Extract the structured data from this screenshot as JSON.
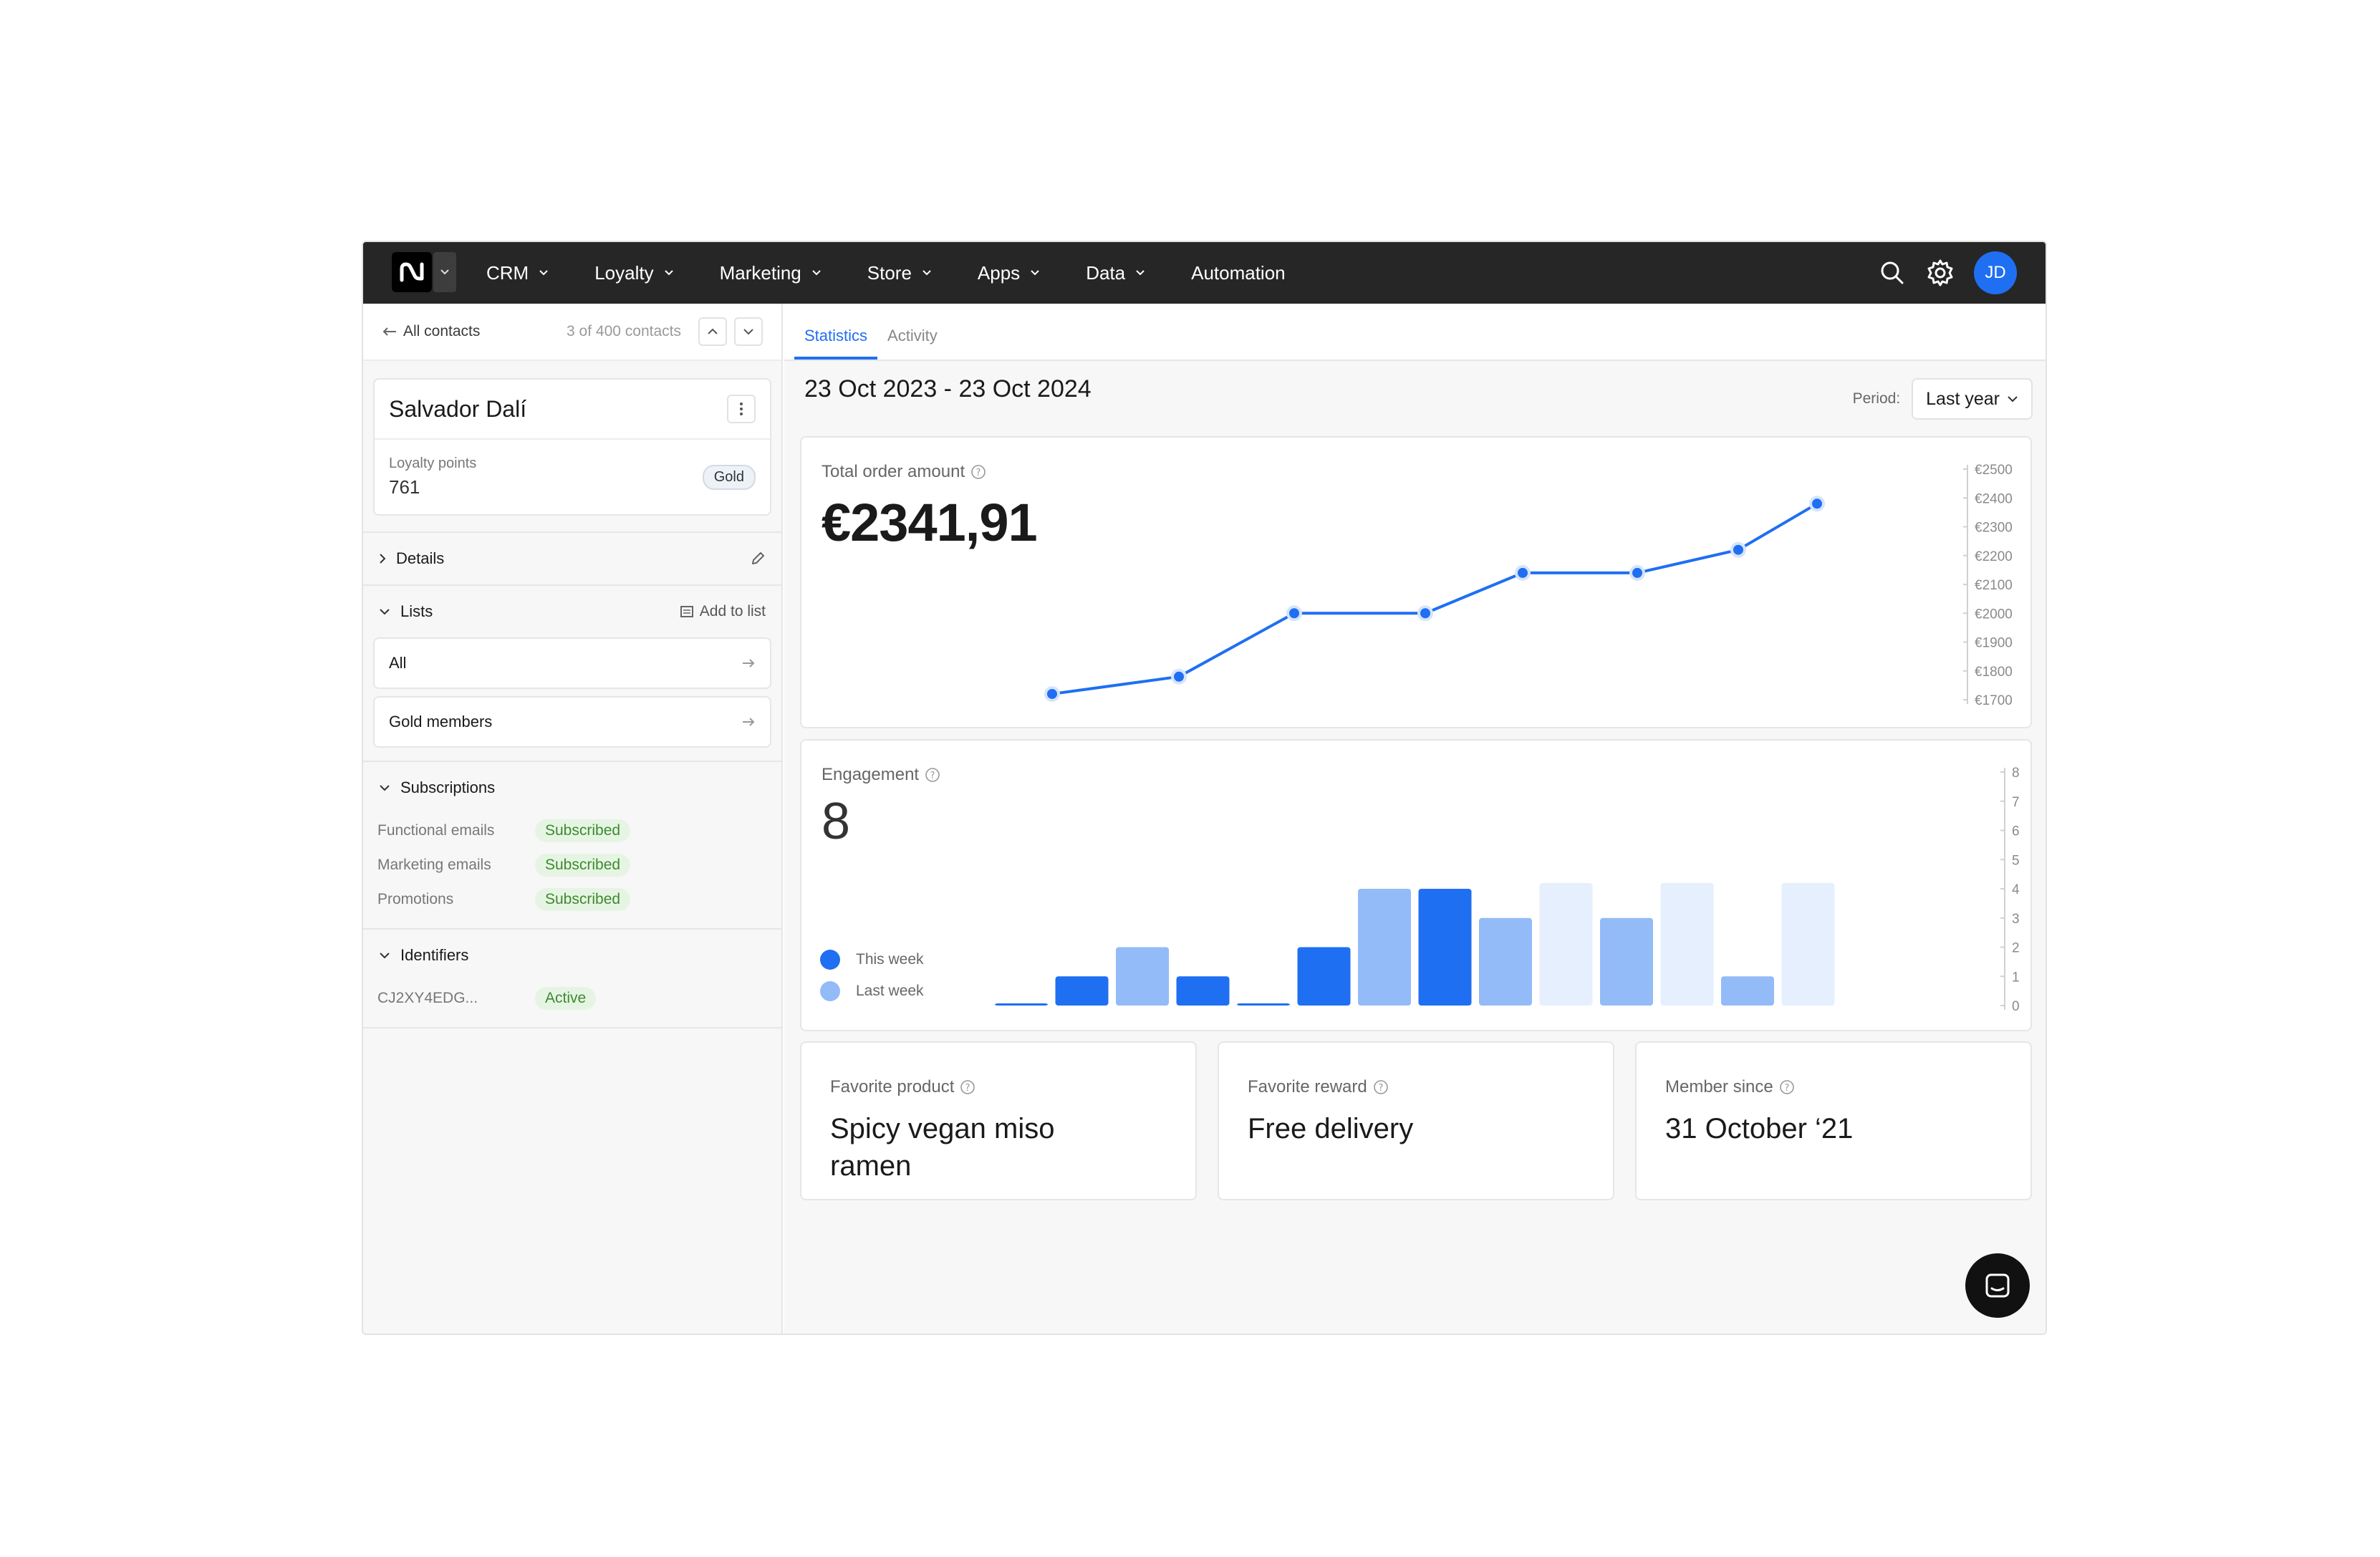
{
  "topbar": {
    "logo_label": "N",
    "nav": [
      "CRM",
      "Loyalty",
      "Marketing",
      "Store",
      "Apps",
      "Data",
      "Automation"
    ],
    "avatar_initials": "JD"
  },
  "sidebar": {
    "back_label": "All contacts",
    "count_label": "3 of 400 contacts",
    "contact_name": "Salvador Dalí",
    "loyalty_label": "Loyalty points",
    "loyalty_value": "761",
    "tier_badge": "Gold",
    "details_label": "Details",
    "lists_label": "Lists",
    "add_to_list_label": "Add to list",
    "lists": [
      "All",
      "Gold members"
    ],
    "subscriptions_label": "Subscriptions",
    "subscriptions": [
      {
        "label": "Functional emails",
        "status": "Subscribed"
      },
      {
        "label": "Marketing emails",
        "status": "Subscribed"
      },
      {
        "label": "Promotions",
        "status": "Subscribed"
      }
    ],
    "identifiers_label": "Identifiers",
    "identifiers": [
      {
        "id": "CJ2XY4EDG...",
        "status": "Active"
      }
    ]
  },
  "main": {
    "tabs": [
      "Statistics",
      "Activity"
    ],
    "date_range": "23 Oct 2023 - 23 Oct 2024",
    "period_label": "Period:",
    "period_value": "Last year",
    "total_order": {
      "label": "Total order amount",
      "value": "€2341,91"
    },
    "engagement": {
      "label": "Engagement",
      "value": "8",
      "legend_this": "This week",
      "legend_last": "Last week"
    },
    "favorite_product": {
      "label": "Favorite product",
      "value": "Spicy vegan miso ramen"
    },
    "favorite_reward": {
      "label": "Favorite reward",
      "value": "Free delivery"
    },
    "member_since": {
      "label": "Member since",
      "value": "31 October ‘21"
    }
  },
  "colors": {
    "accent": "#1f6ff2",
    "light": "#93bbf7",
    "lighter": "#e6effd",
    "topbar": "#262626"
  },
  "chart_data": [
    {
      "type": "line",
      "title": "Total order amount",
      "y_ticks": [
        "€2500",
        "€2400",
        "€2300",
        "€2200",
        "€2100",
        "€2000",
        "€1900",
        "€1800",
        "€1700"
      ],
      "ylim": [
        1700,
        2500
      ],
      "values": [
        1720,
        1780,
        2000,
        2000,
        2140,
        2140,
        2220,
        2380
      ]
    },
    {
      "type": "bar",
      "title": "Engagement",
      "y_ticks": [
        "8",
        "7",
        "6",
        "5",
        "4",
        "3",
        "2",
        "1",
        "0"
      ],
      "ylim": [
        0,
        8
      ],
      "series": [
        {
          "name": "This week",
          "values": [
            0,
            1,
            1,
            0,
            2,
            4,
            4,
            3,
            3,
            1
          ]
        },
        {
          "name": "Last week",
          "values": [
            0,
            0,
            2,
            0,
            0,
            0,
            0,
            0,
            0,
            0
          ]
        }
      ],
      "bars": [
        {
          "v": 0.05,
          "tone": "accent"
        },
        {
          "v": 1,
          "tone": "accent"
        },
        {
          "v": 2,
          "tone": "light"
        },
        {
          "v": 1,
          "tone": "accent"
        },
        {
          "v": 0.05,
          "tone": "accent"
        },
        {
          "v": 2,
          "tone": "accent"
        },
        {
          "v": 4,
          "tone": "light"
        },
        {
          "v": 4,
          "tone": "accent"
        },
        {
          "v": 3,
          "tone": "light"
        },
        {
          "v": 4.2,
          "tone": "lighter"
        },
        {
          "v": 3,
          "tone": "light"
        },
        {
          "v": 4.2,
          "tone": "lighter"
        },
        {
          "v": 1,
          "tone": "light"
        },
        {
          "v": 4.2,
          "tone": "lighter"
        }
      ]
    }
  ]
}
